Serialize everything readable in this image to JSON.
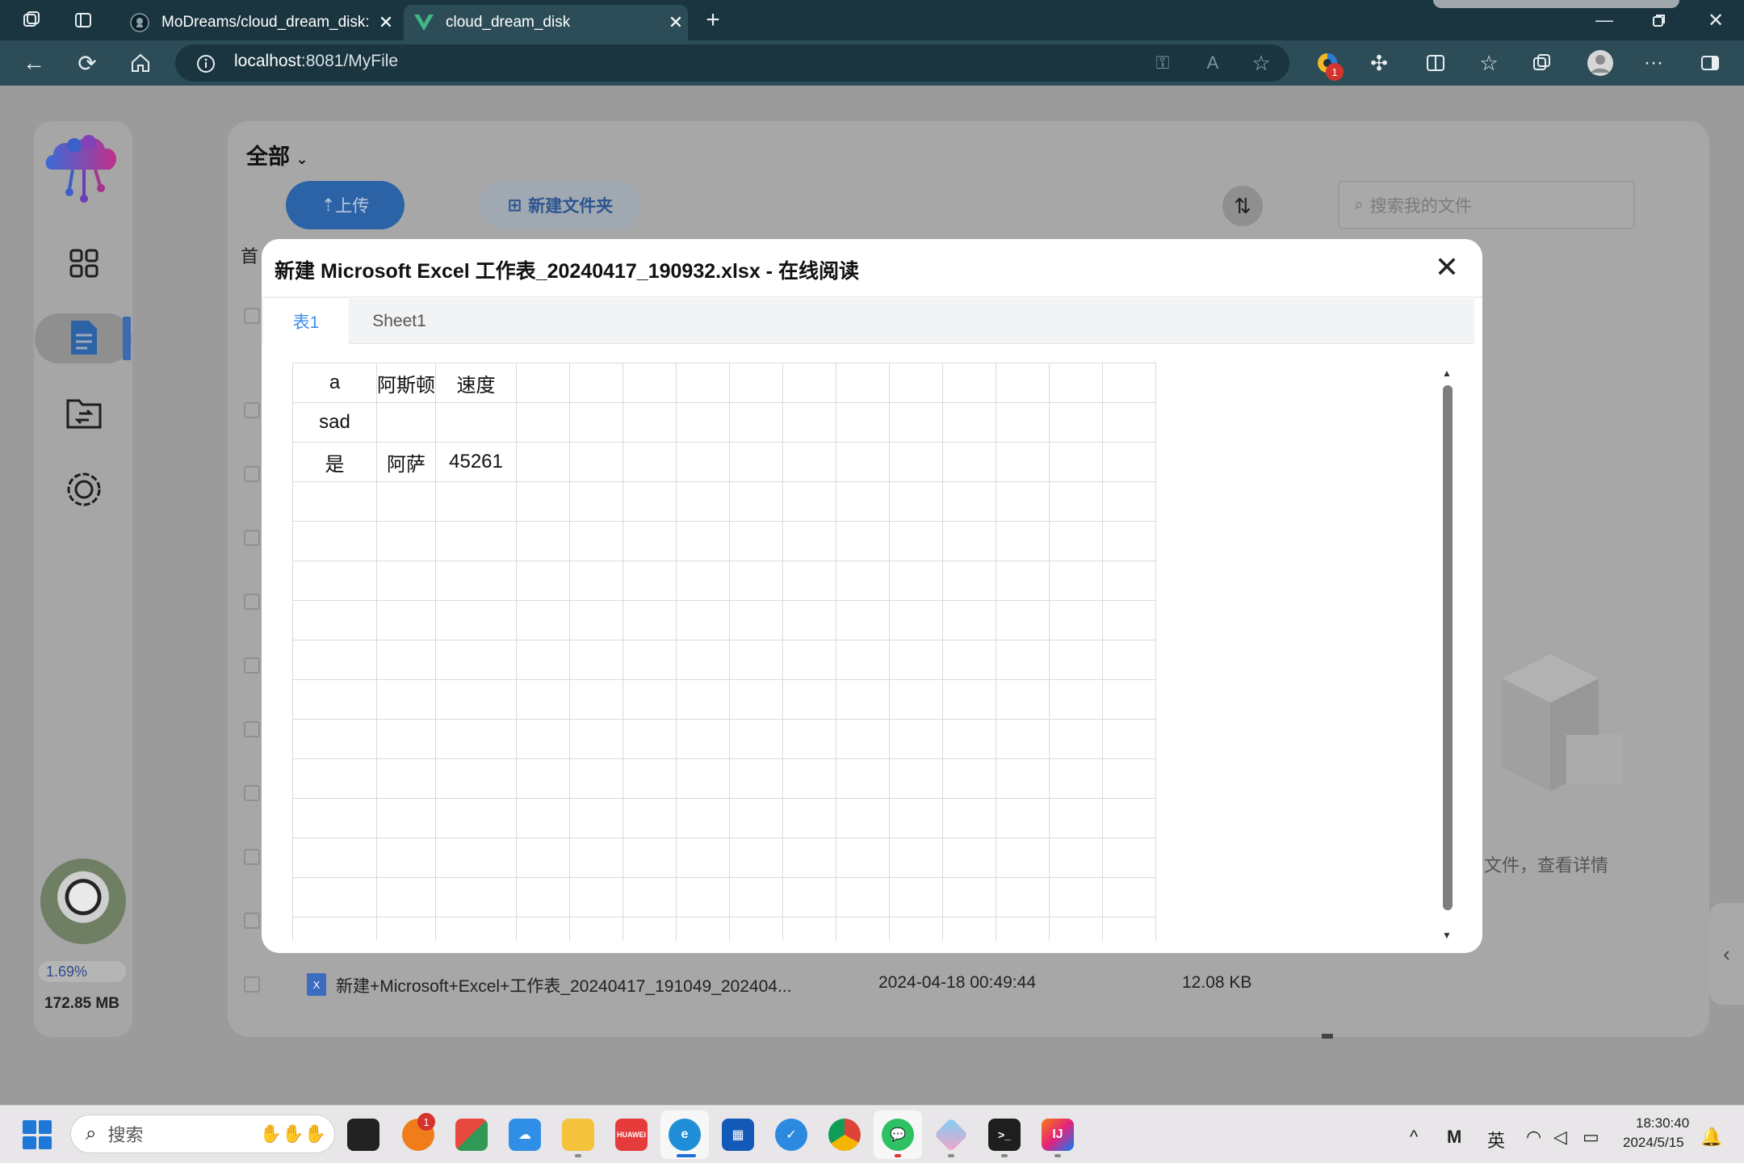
{
  "browser": {
    "tabs": [
      {
        "title": "MoDreams/cloud_dream_disk: ·",
        "active": false,
        "icon": "github-icon"
      },
      {
        "title": "cloud_dream_disk",
        "active": true,
        "icon": "vue-icon"
      }
    ],
    "url_host": "localhost",
    "url_path": ":8081/MyFile",
    "profile_badge": "1"
  },
  "app": {
    "storage_percent": "1.69%",
    "storage_used": "172.85 MB",
    "filter_label": "全部",
    "upload_label": "上传",
    "new_folder_label": "新建文件夹",
    "search_placeholder": "搜索我的文件",
    "breadcrumb_peek": "首",
    "empty_caption": "文件，查看详情",
    "visible_file": {
      "name": "新建+Microsoft+Excel+工作表_20240417_191049_202404...",
      "modified": "2024-04-18 00:49:44",
      "size": "12.08 KB"
    }
  },
  "modal": {
    "title": "新建 Microsoft Excel 工作表_20240417_190932.xlsx - 在线阅读",
    "close_glyph": "✕",
    "sheet_tabs": [
      "表1",
      "Sheet1"
    ],
    "active_sheet": "表1",
    "rows": [
      [
        "a",
        "阿斯顿",
        "速度"
      ],
      [
        "sad",
        "",
        ""
      ],
      [
        "是",
        "阿萨",
        "45261"
      ]
    ]
  },
  "taskbar": {
    "search_label": "搜索",
    "ime_label": "英",
    "time": "18:30:40",
    "date": "2024/5/15",
    "notification_badge": "1"
  },
  "colors": {
    "accent_blue": "#3d8de8",
    "chrome_dark": "#1a3540",
    "chrome_mid": "#2c4d58"
  }
}
